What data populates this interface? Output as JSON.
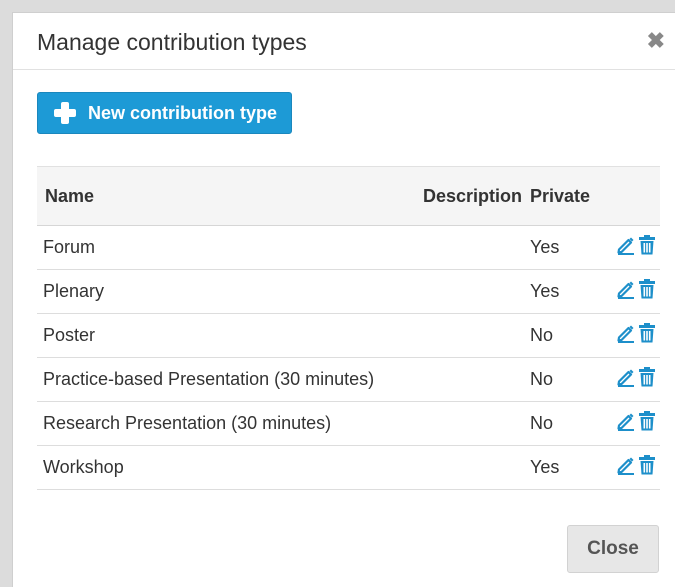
{
  "dialog": {
    "title": "Manage contribution types",
    "close_icon": "close-x-icon"
  },
  "toolbar": {
    "new_label": "New contribution type",
    "new_icon": "plus-icon"
  },
  "table": {
    "headers": {
      "name": "Name",
      "description": "Description",
      "private": "Private"
    },
    "rows": [
      {
        "name": "Forum",
        "description": "",
        "private": "Yes"
      },
      {
        "name": "Plenary",
        "description": "",
        "private": "Yes"
      },
      {
        "name": "Poster",
        "description": "",
        "private": "No"
      },
      {
        "name": "Practice-based Presentation (30 minutes)",
        "description": "",
        "private": "No"
      },
      {
        "name": "Research Presentation (30 minutes)",
        "description": "",
        "private": "No"
      },
      {
        "name": "Workshop",
        "description": "",
        "private": "Yes"
      }
    ],
    "row_actions": [
      "edit-icon",
      "delete-icon"
    ]
  },
  "footer": {
    "close_label": "Close"
  },
  "colors": {
    "accent": "#1d9ad6",
    "icon": "#1d8fca"
  }
}
